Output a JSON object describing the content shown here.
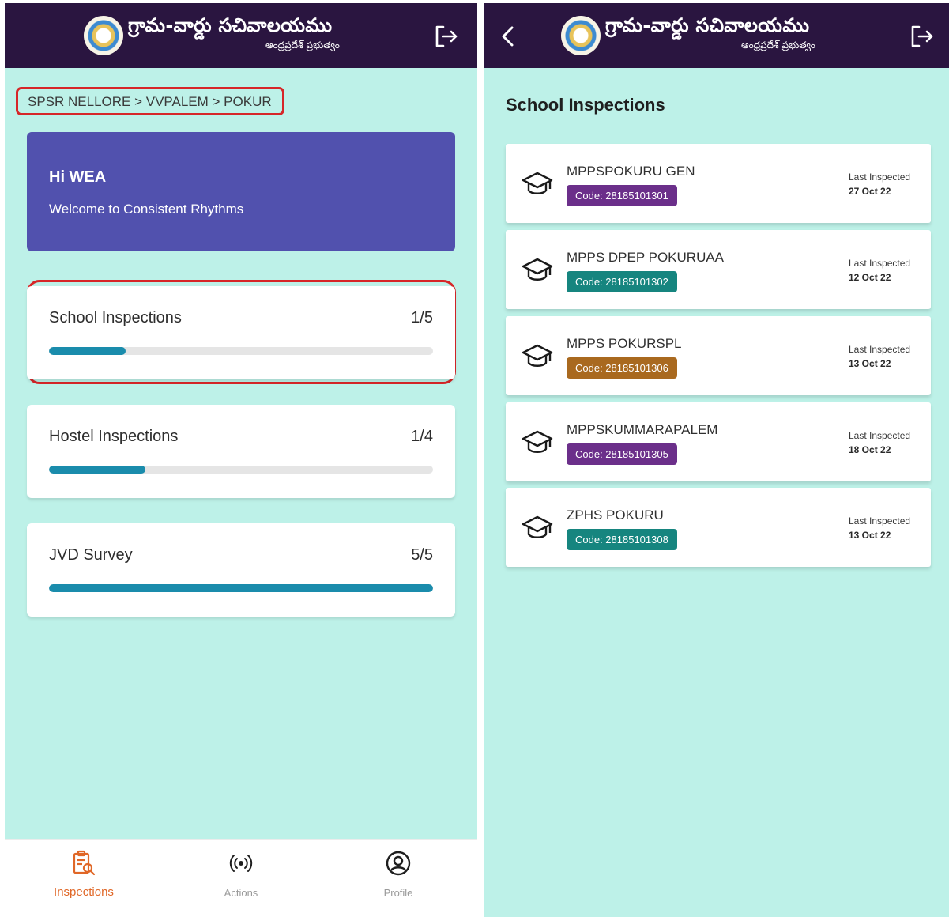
{
  "header": {
    "title": "గ్రామ-వార్డు సచివాలయము",
    "subtitle": "ఆంధ్రప్రదేశ్ ప్రభుత్వం",
    "logo_icon": "state-emblem-icon",
    "logout_icon": "logout-icon",
    "back_icon": "back-arrow-icon"
  },
  "home": {
    "breadcrumb": "SPSR NELLORE > VVPALEM > POKUR",
    "welcome": {
      "title": "Hi WEA",
      "subtitle": "Welcome to Consistent Rhythms"
    },
    "cards": [
      {
        "title": "School Inspections",
        "count": "1/5",
        "progress": 0.2
      },
      {
        "title": "Hostel Inspections",
        "count": "1/4",
        "progress": 0.25
      },
      {
        "title": "JVD Survey",
        "count": "5/5",
        "progress": 1.0
      }
    ],
    "nav": [
      {
        "label": "Inspections",
        "icon": "clipboard-search-icon",
        "active": true
      },
      {
        "label": "Actions",
        "icon": "broadcast-icon",
        "active": false
      },
      {
        "label": "Profile",
        "icon": "user-circle-icon",
        "active": false
      }
    ]
  },
  "school_list": {
    "title": "School Inspections",
    "last_label": "Last Inspected",
    "items": [
      {
        "name": "MPPSPOKURU GEN",
        "code": "Code: 28185101301",
        "date": "27 Oct 22",
        "badge_color": "#6b2f8a"
      },
      {
        "name": "MPPS DPEP POKURUAA",
        "code": "Code: 28185101302",
        "date": "12 Oct 22",
        "badge_color": "#16857f"
      },
      {
        "name": "MPPS POKURSPL",
        "code": "Code: 28185101306",
        "date": "13 Oct 22",
        "badge_color": "#a9691f"
      },
      {
        "name": "MPPSKUMMARAPALEM",
        "code": "Code: 28185101305",
        "date": "18 Oct 22",
        "badge_color": "#6b2f8a"
      },
      {
        "name": "ZPHS POKURU",
        "code": "Code: 28185101308",
        "date": "13 Oct 22",
        "badge_color": "#16857f"
      }
    ]
  },
  "colors": {
    "background": "#bdf1e8",
    "appbar": "#2a1540",
    "welcome_card": "#5151ae",
    "progress": "#1a8cac",
    "active_nav": "#e06727",
    "highlight": "#d62628"
  }
}
